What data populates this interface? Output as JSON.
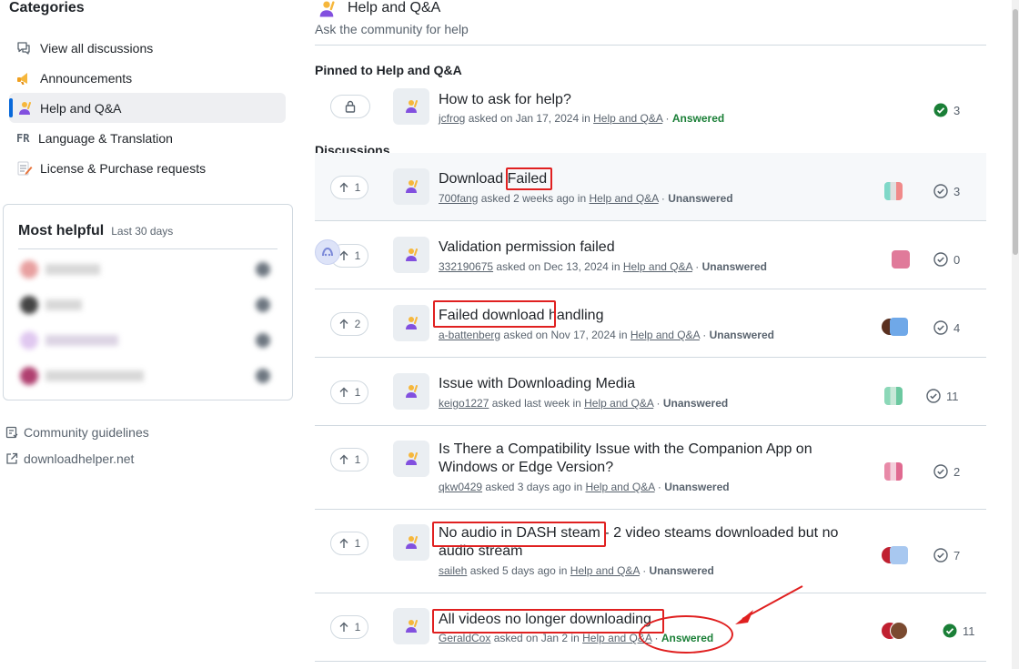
{
  "sidebar": {
    "heading": "Categories",
    "items": [
      {
        "label": "View all discussions",
        "icon": "discussions-icon"
      },
      {
        "label": "Announcements",
        "icon": "megaphone-icon"
      },
      {
        "label": "Help and Q&A",
        "icon": "person-raising-hand-icon",
        "active": true
      },
      {
        "label": "Language & Translation",
        "icon": "fr-badge-icon",
        "badge": "FR"
      },
      {
        "label": "License & Purchase requests",
        "icon": "memo-icon"
      }
    ],
    "most_helpful": {
      "title": "Most helpful",
      "subtitle": "Last 30 days"
    },
    "links": [
      {
        "label": "Community guidelines",
        "icon": "guidelines-icon"
      },
      {
        "label": "downloadhelper.net",
        "icon": "external-link-icon"
      }
    ]
  },
  "header": {
    "title": "Help and Q&A",
    "description": "Ask the community for help"
  },
  "pinned": {
    "label": "Pinned to Help and Q&A",
    "item": {
      "title": "How to ask for help?",
      "author": "jcfrog",
      "asked_text": "asked on Jan 17, 2024 in",
      "category": "Help and Q&A",
      "status": "Answered",
      "comments": "3"
    }
  },
  "discussions": {
    "label": "Discussions",
    "items": [
      {
        "votes": "1",
        "title": "Download Failed",
        "author": "700fang",
        "asked_text": "asked 2 weeks ago in",
        "category": "Help and Q&A",
        "status": "Unanswered",
        "comments": "3"
      },
      {
        "votes": "1",
        "title": "Validation permission failed",
        "author": "332190675",
        "asked_text": "asked on Dec 13, 2024 in",
        "category": "Help and Q&A",
        "status": "Unanswered",
        "comments": "0"
      },
      {
        "votes": "2",
        "title": "Failed download handling",
        "author": "a-battenberg",
        "asked_text": "asked on Nov 17, 2024 in",
        "category": "Help and Q&A",
        "status": "Unanswered",
        "comments": "4"
      },
      {
        "votes": "1",
        "title": "Issue with Downloading Media",
        "author": "keigo1227",
        "asked_text": "asked last week in",
        "category": "Help and Q&A",
        "status": "Unanswered",
        "comments": "11"
      },
      {
        "votes": "1",
        "title": "Is There a Compatibility Issue with the Companion App on Windows or Edge Version?",
        "author": "qkw0429",
        "asked_text": "asked 3 days ago in",
        "category": "Help and Q&A",
        "status": "Unanswered",
        "comments": "2"
      },
      {
        "votes": "1",
        "title": "No audio in DASH steam - 2 video steams downloaded but no audio stream",
        "author": "saileh",
        "asked_text": "asked 5 days ago in",
        "category": "Help and Q&A",
        "status": "Unanswered",
        "comments": "7"
      },
      {
        "votes": "1",
        "title": "All videos no longer downloading",
        "author": "GeraldCox",
        "asked_text": "asked on Jan 2 in",
        "category": "Help and Q&A",
        "status": "Answered",
        "comments": "11"
      }
    ]
  },
  "separator": " · ",
  "colors": {
    "accent": "#0969da",
    "answered": "#1a7f37",
    "highlight": "#e02020"
  }
}
